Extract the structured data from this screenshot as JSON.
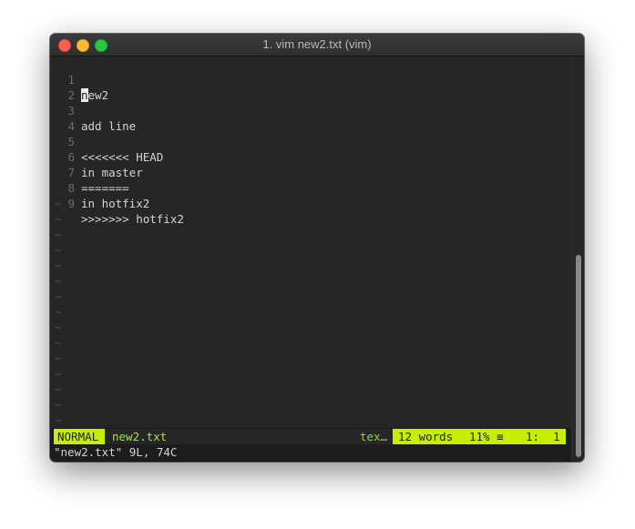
{
  "window": {
    "title": "1. vim new2.txt (vim)"
  },
  "buffer": {
    "lines": [
      {
        "num": "1",
        "cursor_char": "n",
        "rest": "ew2"
      },
      {
        "num": "2",
        "text": ""
      },
      {
        "num": "3",
        "text": "add line"
      },
      {
        "num": "4",
        "text": ""
      },
      {
        "num": "5",
        "text": "<<<<<<< HEAD"
      },
      {
        "num": "6",
        "text": "in master"
      },
      {
        "num": "7",
        "text": "======="
      },
      {
        "num": "8",
        "text": "in hotfix2"
      },
      {
        "num": "9",
        "text": ">>>>>>> hotfix2"
      }
    ],
    "tilde": "~"
  },
  "statusline": {
    "mode": "NORMAL",
    "filename": "new2.txt",
    "filetype": "tex…",
    "words": "12 words",
    "percent": "11% ≡",
    "position": "1:  1"
  },
  "cmdline": {
    "message": "\"new2.txt\" 9L, 74C"
  },
  "colors": {
    "mode_bg": "#c8ee00",
    "editor_bg": "#262626",
    "filename_fg": "#9ee64a"
  }
}
